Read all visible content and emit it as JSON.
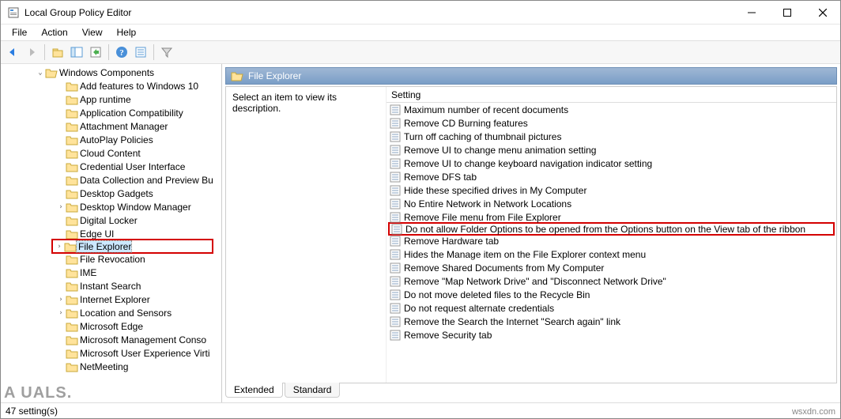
{
  "title": "Local Group Policy Editor",
  "menu": {
    "file": "File",
    "action": "Action",
    "view": "View",
    "help": "Help"
  },
  "tree": {
    "root": "Windows Components",
    "items": [
      "Add features to Windows 10",
      "App runtime",
      "Application Compatibility",
      "Attachment Manager",
      "AutoPlay Policies",
      "Cloud Content",
      "Credential User Interface",
      "Data Collection and Preview Bu",
      "Desktop Gadgets",
      "Desktop Window Manager",
      "Digital Locker",
      "Edge UI",
      "File Explorer",
      "File Revocation",
      "IME",
      "Instant Search",
      "Internet Explorer",
      "Location and Sensors",
      "Microsoft Edge",
      "Microsoft Management Conso",
      "Microsoft User Experience Virti",
      "NetMeeting"
    ],
    "selected": "File Explorer",
    "expandable": [
      "Desktop Window Manager",
      "File Explorer",
      "Internet Explorer",
      "Location and Sensors"
    ]
  },
  "detail": {
    "header": "File Explorer",
    "desc_prompt": "Select an item to view its description.",
    "col": "Setting",
    "settings": [
      "Maximum number of recent documents",
      "Remove CD Burning features",
      "Turn off caching of thumbnail pictures",
      "Remove UI to change menu animation setting",
      "Remove UI to change keyboard navigation indicator setting",
      "Remove DFS tab",
      "Hide these specified drives in My Computer",
      "No Entire Network in Network Locations",
      "Remove File menu from File Explorer",
      "Do not allow Folder Options to be opened from the Options button on the View tab of the ribbon",
      "Remove Hardware tab",
      "Hides the Manage item on the File Explorer context menu",
      "Remove Shared Documents from My Computer",
      "Remove \"Map Network Drive\" and \"Disconnect Network Drive\"",
      "Do not move deleted files to the Recycle Bin",
      "Do not request alternate credentials",
      "Remove the Search the Internet \"Search again\" link",
      "Remove Security tab"
    ],
    "highlighted_row": 9,
    "tabs": {
      "extended": "Extended",
      "standard": "Standard"
    }
  },
  "status": "47 setting(s)",
  "watermark_right": "wsxdn.com",
  "watermark_left": "A   UALS."
}
